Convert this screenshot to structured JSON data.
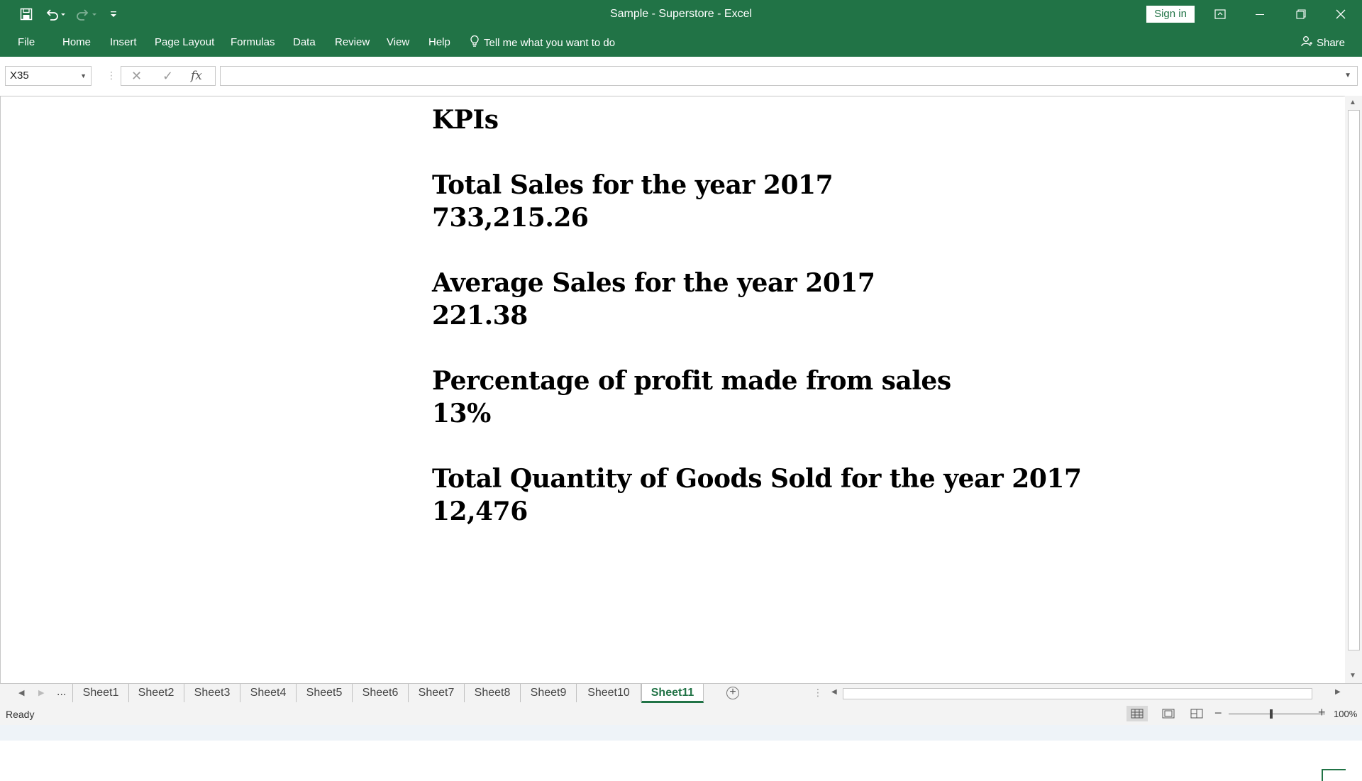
{
  "app": {
    "title": "Sample - Superstore  -  Excel",
    "sign_in": "Sign in"
  },
  "ribbon": {
    "tabs": [
      "File",
      "Home",
      "Insert",
      "Page Layout",
      "Formulas",
      "Data",
      "Review",
      "View",
      "Help"
    ],
    "tell_me": "Tell me what you want to do",
    "share": "Share"
  },
  "formula_bar": {
    "name_box": "X35",
    "fx": "fx",
    "formula": ""
  },
  "sheet": {
    "content": [
      "KPIs",
      "Total Sales for the year 2017",
      "733,215.26",
      "Average Sales for the year 2017",
      "221.38",
      "Percentage of profit made from sales",
      "13%",
      "Total Quantity of Goods Sold for the year 2017",
      "12,476"
    ]
  },
  "sheet_tabs": {
    "ellipsis": "...",
    "tabs": [
      "Sheet1",
      "Sheet2",
      "Sheet3",
      "Sheet4",
      "Sheet5",
      "Sheet6",
      "Sheet7",
      "Sheet8",
      "Sheet9",
      "Sheet10",
      "Sheet11"
    ],
    "active": "Sheet11"
  },
  "status_bar": {
    "status": "Ready",
    "zoom": "100%"
  },
  "colors": {
    "accent": "#217346",
    "background": "#ffffff"
  }
}
